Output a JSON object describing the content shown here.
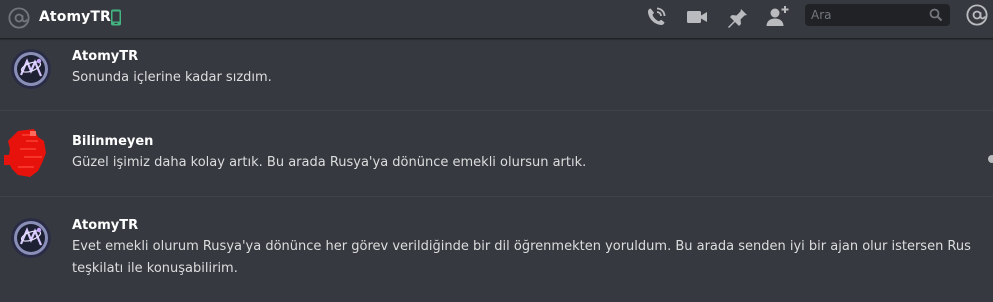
{
  "header": {
    "channel_name": "AtomyTR",
    "search_placeholder": "Ara"
  },
  "messages": [
    {
      "author": "AtomyTR",
      "text": "Sonunda içlerine kadar sızdım."
    },
    {
      "author": "Bilinmeyen",
      "text": "Güzel işimiz daha kolay artık. Bu arada Rusya'ya dönünce emekli olursun artık."
    },
    {
      "author": "AtomyTR",
      "text": "Evet emekli olurum Rusya'ya dönünce her görev verildiğinde bir dil öğrenmekten yoruldum. Bu arada senden iyi bir ajan olur istersen Rus teşkilatı ile konuşabilirim."
    }
  ],
  "colors": {
    "background": "#36393f",
    "online_green": "#43b581",
    "search_bg": "#202225",
    "unknown_avatar_red": "#e8120c"
  },
  "icons": {
    "header": "at-icon",
    "status": "mobile-icon",
    "call": "phone-call-icon",
    "video": "video-call-icon",
    "pin": "pin-icon",
    "add_member": "add-friend-icon",
    "search": "search-icon",
    "mentions": "mention-icon"
  }
}
